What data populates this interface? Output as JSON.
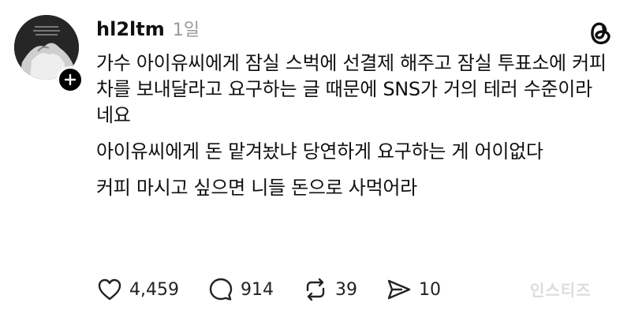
{
  "post": {
    "username": "hl2ltm",
    "time": "1일",
    "paragraphs": [
      "가수 아이유씨에게 잠실 스벅에 선결제 해주고 잠실 투표소에 커피차를 보내달라고 요구하는 글 때문에 SNS가 거의 테러 수준이라네요",
      "아이유씨에게 돈 맡겨놨냐 당연하게 요구하는 게 어이없다",
      "커피 마시고 싶으면 니들 돈으로 사먹어라"
    ]
  },
  "actions": {
    "likes": "4,459",
    "replies": "914",
    "reposts": "39",
    "shares": "10"
  },
  "watermark": "인스티즈",
  "icons": [
    "plus-icon",
    "threads-logo-icon",
    "heart-icon",
    "comment-icon",
    "repost-icon",
    "share-icon"
  ]
}
